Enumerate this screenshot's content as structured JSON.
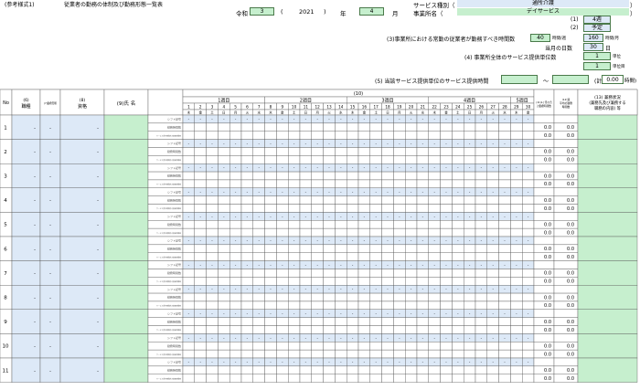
{
  "header": {
    "form_ref": "(参考様式1)",
    "doc_title": "従業者の勤務の体制及び勤務形態一覧表",
    "era": "令和",
    "era_year": "3",
    "year_open": "(",
    "western_year": "2021",
    "year_close": ")",
    "year_unit": "年",
    "month": "4",
    "month_unit": "月",
    "service_type_label": "サービス種別（",
    "service_type_value": "通所介護",
    "service_type_close": "）",
    "office_name_label": "事業所名（",
    "office_name_value": "デイサービス",
    "office_name_close": "）"
  },
  "settings": {
    "item1_label": "(1)",
    "item1_value": "4週",
    "item2_label": "(2)",
    "item2_value": "予定",
    "item3_label": "(3)事業所における常勤の従業者が勤務すべき時間数",
    "item3_week_value": "40",
    "item3_week_unit": "時間/週",
    "item3_month_value": "160",
    "item3_month_unit": "時間/月",
    "days_label": "当月の日数",
    "days_value": "30",
    "days_unit": "日",
    "item4_label": "(4) 事業所全体のサービス提供単位数",
    "item4_value": "1",
    "item4_unit": "単位",
    "item4_sub_value": "1",
    "item4_sub_unit": "単位目",
    "item5_label": "(5) 当該サービス提供単位のサービス提供時間",
    "item5_tilde": "〜",
    "item5_total_label": "(計",
    "item5_total_value": "0.00",
    "item5_total_unit": "時間)"
  },
  "table": {
    "col_no": "No",
    "col_6_num": "(6)",
    "col_6_label": "職種",
    "col_7": "(7)勤務形態",
    "col_8_num": "(8)",
    "col_8_label": "資格",
    "col_9": "(9)氏 名",
    "col_10": "(10)",
    "weeks": [
      "1週目",
      "2週目",
      "3週目",
      "4週目",
      "5週目"
    ],
    "dates": [
      "1",
      "2",
      "3",
      "4",
      "5",
      "6",
      "7",
      "8",
      "9",
      "10",
      "11",
      "12",
      "13",
      "14",
      "15",
      "16",
      "17",
      "18",
      "19",
      "20",
      "21",
      "22",
      "23",
      "24",
      "25",
      "26",
      "27",
      "28",
      "29",
      "30"
    ],
    "weekdays": [
      "木",
      "金",
      "土",
      "日",
      "月",
      "火",
      "水",
      "木",
      "金",
      "土",
      "日",
      "月",
      "火",
      "水",
      "木",
      "金",
      "土",
      "日",
      "月",
      "火",
      "水",
      "木",
      "金",
      "土",
      "日",
      "月",
      "火",
      "水",
      "木",
      "金"
    ],
    "col_11": "(11)1ヶ月の合計勤務時間数",
    "col_12": "(12)週平均の勤務時間数",
    "col_13_line1": "(13) 兼務状況",
    "col_13_line2": "(兼務先及び兼務する",
    "col_13_line3": "職務の内容) 等",
    "sub_row_1": "シフト記号",
    "sub_row_2": "勤務時間数",
    "sub_row_3": "サービス提供時間内の勤務時間数",
    "dash": "-",
    "zero": "0.0",
    "rows": [
      "1",
      "2",
      "3",
      "4",
      "5",
      "6",
      "7",
      "8",
      "9",
      "10",
      "11"
    ]
  }
}
